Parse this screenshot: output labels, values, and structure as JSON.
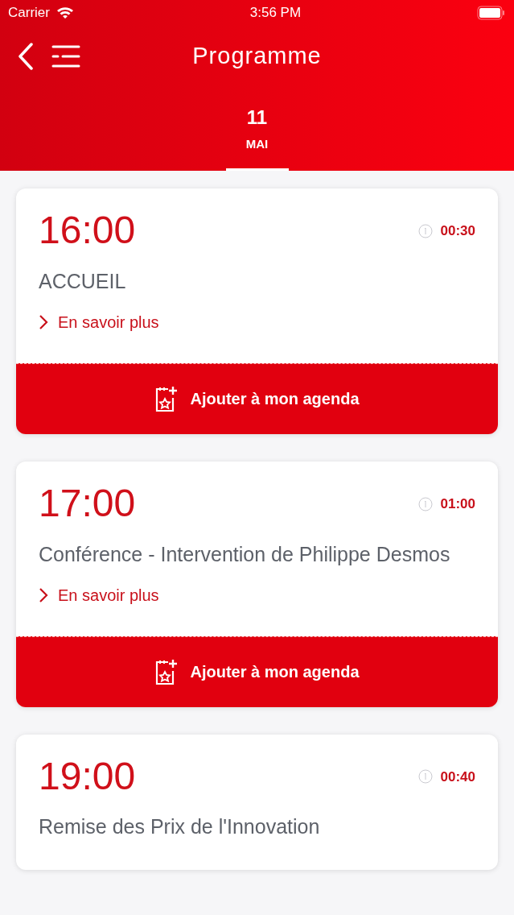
{
  "status_bar": {
    "carrier": "Carrier",
    "time": "3:56 PM"
  },
  "header": {
    "title": "Programme"
  },
  "tabs": [
    {
      "day": "11",
      "month": "MAI",
      "selected": true
    }
  ],
  "events": [
    {
      "time": "16:00",
      "duration": "00:30",
      "title": "ACCUEIL",
      "link": "En savoir plus",
      "add_button": "Ajouter à mon agenda"
    },
    {
      "time": "17:00",
      "duration": "01:00",
      "title": "Conférence - Intervention de Philippe Desmos",
      "link": "En savoir plus",
      "add_button": "Ajouter à mon agenda"
    },
    {
      "time": "19:00",
      "duration": "00:40",
      "title": "Remise des Prix de l'Innovation"
    }
  ]
}
